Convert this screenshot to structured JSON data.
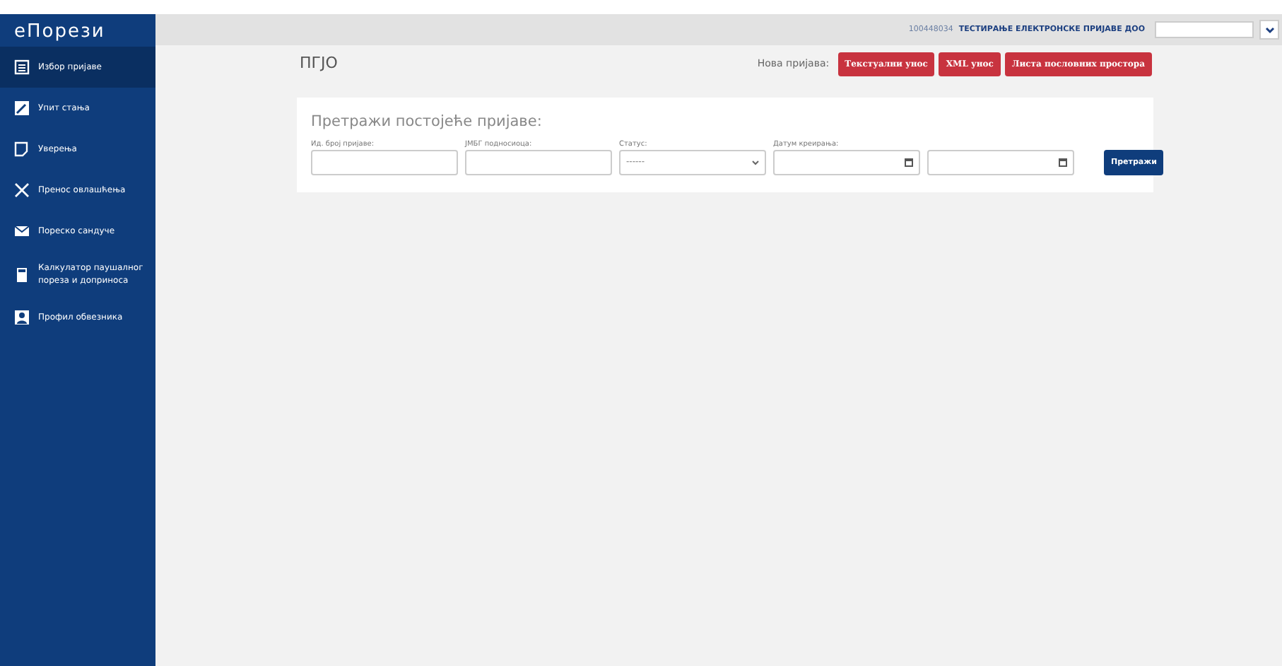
{
  "logo": "еПорези",
  "sidebar": {
    "items": [
      {
        "label": "Избор пријаве",
        "kind": "form",
        "selected": true
      },
      {
        "label": "Упит стања",
        "kind": "edit",
        "selected": false
      },
      {
        "label": "Уверења",
        "kind": "doc",
        "selected": false
      },
      {
        "label": "Пренос овлашћења",
        "kind": "cross",
        "selected": false
      },
      {
        "label": "Пореско сандуче",
        "kind": "mail",
        "selected": false
      },
      {
        "label": "Калкулатор паушалног пореза и доприноса",
        "kind": "calc",
        "selected": false
      },
      {
        "label": "Профил обвезника",
        "kind": "user",
        "selected": false
      }
    ]
  },
  "topbar": {
    "id": "100448034",
    "company": "ТЕСТИРАЊЕ ЕЛЕКТРОНСКЕ ПРИЈАВЕ ДОО"
  },
  "page_title": "ПГЈО",
  "new_filing": {
    "label": "Нова пријава:",
    "buttons": [
      "Текстуални унос",
      "XML унос",
      "Листа пословних простора"
    ]
  },
  "search": {
    "title": "Претражи постојеће пријаве:",
    "fields": [
      {
        "kind": "text",
        "label": "Ид. број пријаве:"
      },
      {
        "kind": "text",
        "label": "ЈМБГ подносиоца:"
      },
      {
        "kind": "select",
        "label": "Статус:",
        "value": "------"
      },
      {
        "kind": "date",
        "label": "Датум креирања:"
      },
      {
        "kind": "date"
      }
    ],
    "button": "Претражи"
  }
}
